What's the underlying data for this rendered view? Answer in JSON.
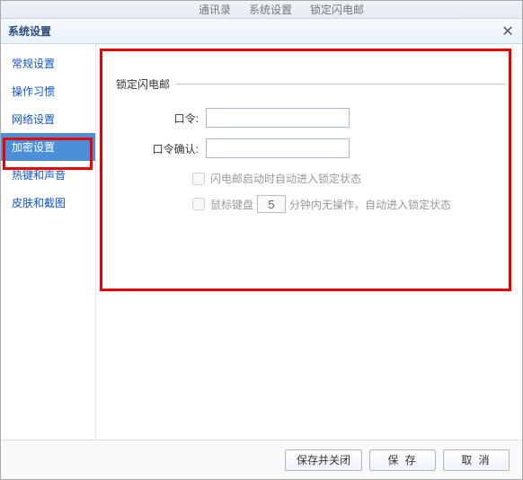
{
  "top_tabs": {
    "t1": "通讯录",
    "t2": "系统设置",
    "t3": "锁定闪电邮"
  },
  "title": "系统设置",
  "close_glyph": "✕",
  "sidebar": {
    "items": [
      {
        "label": "常规设置"
      },
      {
        "label": "操作习惯"
      },
      {
        "label": "网络设置"
      },
      {
        "label": "加密设置"
      },
      {
        "label": "热键和声音"
      },
      {
        "label": "皮肤和截图"
      }
    ],
    "selected_index": 3
  },
  "section": {
    "legend": "锁定闪电邮",
    "password_label": "口令:",
    "confirm_label": "口令确认:",
    "password_value": "",
    "confirm_value": "",
    "check1_label": "闪电邮启动时自动进入锁定状态",
    "check2_prefix": "鼠标键盘",
    "check2_minutes": "5",
    "check2_suffix": "分钟内无操作，自动进入锁定状态"
  },
  "footer": {
    "save_close": "保存并关闭",
    "save": "保 存",
    "cancel": "取 消"
  }
}
